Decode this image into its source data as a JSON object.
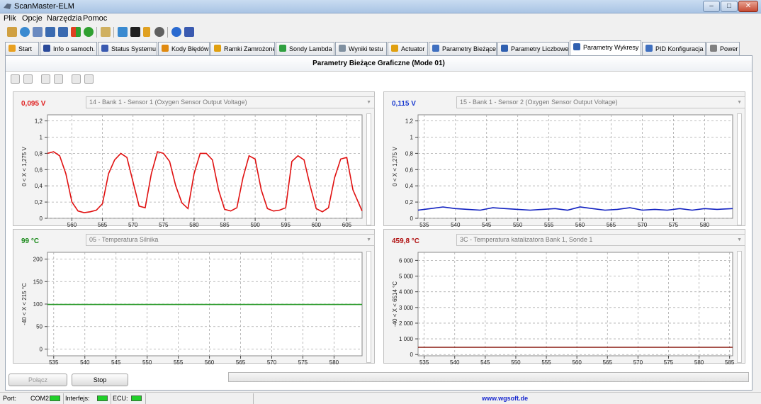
{
  "window": {
    "title": "ScanMaster-ELM",
    "min_label": "–",
    "max_label": "□",
    "close_label": "✕"
  },
  "menu": [
    "Plik",
    "Opcje",
    "Narzędzia",
    "Pomoc"
  ],
  "toolbar_icons": [
    "connect-icon",
    "globe-icon",
    "document-icon",
    "grid-icon",
    "chart-icon",
    "windows-icon",
    "dollar-icon",
    "clipboard-icon",
    "monitor-icon",
    "terminal-icon",
    "battery-icon",
    "disc-icon",
    "info-icon",
    "book-icon"
  ],
  "tabs": [
    {
      "label": "Start",
      "color": "#e8a020"
    },
    {
      "label": "Info o samoch.",
      "color": "#2a4a9a"
    },
    {
      "label": "Status Systemu",
      "color": "#3a5ab0"
    },
    {
      "label": "Kody Błędów",
      "color": "#e08a10"
    },
    {
      "label": "Ramki Zamrożone",
      "color": "#e0a010"
    },
    {
      "label": "Sondy Lambda",
      "color": "#30a040"
    },
    {
      "label": "Wyniki testu",
      "color": "#8090a0"
    },
    {
      "label": "Actuator",
      "color": "#e0a010"
    },
    {
      "label": "Parametry Bieżące",
      "color": "#4070c0"
    },
    {
      "label": "Parametry Liczbowe",
      "color": "#3060b0"
    },
    {
      "label": "Parametry Wykresy",
      "color": "#3060b0",
      "active": true
    },
    {
      "label": "PID Konfiguracja",
      "color": "#4070c0"
    },
    {
      "label": "Power",
      "color": "#808080"
    }
  ],
  "panel": {
    "title": "Parametry Bieżące Graficzne (Mode 01)"
  },
  "charts": [
    {
      "value": "0,095 V",
      "value_color": "#e02020",
      "pid": "14 - Bank 1 - Sensor 1 (Oxygen Sensor Output Voltage)",
      "ylabel": "0  < X <  1,275  V",
      "line_color": "#e01010"
    },
    {
      "value": "0,115 V",
      "value_color": "#1a3ad0",
      "pid": "15 - Bank 1 - Sensor 2 (Oxygen Sensor Output Voltage)",
      "ylabel": "0  < X <  1,275  V",
      "line_color": "#1020c0"
    },
    {
      "value": "99 °C",
      "value_color": "#1a8a1a",
      "pid": "05 - Temperatura Silnika",
      "ylabel": "-40  < X <  215  °C",
      "line_color": "#2a9a2a"
    },
    {
      "value": "459,8 °C",
      "value_color": "#b01010",
      "pid": "3C - Temperatura katalizatora Bank 1, Sonde 1",
      "ylabel": "-40  < X <  6514  °C",
      "line_color": "#8a1a10"
    }
  ],
  "chart_data": [
    {
      "type": "line",
      "title": "",
      "ylabel": "0  < X <  1,275  V",
      "xlim": [
        556,
        607.5
      ],
      "ylim": [
        0,
        1.275
      ],
      "yticks": [
        0,
        0.2,
        0.4,
        0.6,
        0.8,
        1,
        1.2
      ],
      "ytick_labels": [
        "0",
        "0,2",
        "0,4",
        "0,6",
        "0,8",
        "1",
        "1,2"
      ],
      "xticks": [
        560,
        565,
        570,
        575,
        580,
        585,
        590,
        595,
        600,
        605
      ],
      "series": [
        {
          "x": [
            556,
            557,
            558,
            559,
            560,
            561,
            562,
            563,
            564,
            565,
            566,
            567,
            568,
            569,
            570,
            571,
            572,
            573,
            574,
            575,
            576,
            577,
            578,
            579,
            580,
            581,
            582,
            583,
            584,
            585,
            586,
            587,
            588,
            589,
            590,
            591,
            592,
            593,
            594,
            595,
            596,
            597,
            598,
            599,
            600,
            601,
            602,
            603,
            604,
            605,
            606,
            607.5
          ],
          "y": [
            0.8,
            0.82,
            0.77,
            0.55,
            0.2,
            0.09,
            0.07,
            0.08,
            0.1,
            0.18,
            0.55,
            0.72,
            0.8,
            0.75,
            0.45,
            0.15,
            0.13,
            0.55,
            0.82,
            0.8,
            0.7,
            0.4,
            0.19,
            0.12,
            0.55,
            0.8,
            0.8,
            0.72,
            0.35,
            0.11,
            0.09,
            0.13,
            0.5,
            0.77,
            0.73,
            0.35,
            0.12,
            0.09,
            0.1,
            0.13,
            0.7,
            0.77,
            0.72,
            0.4,
            0.12,
            0.08,
            0.13,
            0.5,
            0.73,
            0.75,
            0.35,
            0.09
          ]
        }
      ]
    },
    {
      "type": "line",
      "title": "",
      "ylabel": "0  < X <  1,275  V",
      "xlim": [
        534,
        584.5
      ],
      "ylim": [
        0,
        1.275
      ],
      "yticks": [
        0,
        0.2,
        0.4,
        0.6,
        0.8,
        1,
        1.2
      ],
      "ytick_labels": [
        "0",
        "0,2",
        "0,4",
        "0,6",
        "0,8",
        "1",
        "1,2"
      ],
      "xticks": [
        535,
        540,
        545,
        550,
        555,
        560,
        565,
        570,
        575,
        580
      ],
      "series": [
        {
          "x": [
            534,
            536,
            538,
            540,
            542,
            544,
            546,
            548,
            550,
            552,
            554,
            556,
            558,
            560,
            562,
            564,
            566,
            568,
            570,
            572,
            574,
            576,
            578,
            580,
            582,
            584.5
          ],
          "y": [
            0.1,
            0.12,
            0.14,
            0.12,
            0.11,
            0.1,
            0.13,
            0.12,
            0.11,
            0.1,
            0.11,
            0.12,
            0.1,
            0.14,
            0.12,
            0.1,
            0.11,
            0.13,
            0.1,
            0.11,
            0.1,
            0.12,
            0.1,
            0.12,
            0.11,
            0.12
          ]
        }
      ]
    },
    {
      "type": "line",
      "title": "",
      "ylabel": "-40  < X <  215  °C",
      "xlim": [
        534,
        584.5
      ],
      "ylim": [
        -15,
        215
      ],
      "yticks": [
        0,
        50,
        100,
        150,
        200
      ],
      "ytick_labels": [
        "0",
        "50",
        "100",
        "150",
        "200"
      ],
      "xticks": [
        535,
        540,
        545,
        550,
        555,
        560,
        565,
        570,
        575,
        580
      ],
      "series": [
        {
          "x": [
            534,
            584.5
          ],
          "y": [
            99,
            99
          ]
        }
      ]
    },
    {
      "type": "line",
      "title": "",
      "ylabel": "-40  < X <  6514  °C",
      "xlim": [
        534,
        585.5
      ],
      "ylim": [
        -80,
        6514
      ],
      "yticks": [
        0,
        1000,
        2000,
        3000,
        4000,
        5000,
        6000
      ],
      "ytick_labels": [
        "0",
        "1 000",
        "2 000",
        "3 000",
        "4 000",
        "5 000",
        "6 000"
      ],
      "xticks": [
        535,
        540,
        545,
        550,
        555,
        560,
        565,
        570,
        575,
        580,
        585
      ],
      "series": [
        {
          "x": [
            534,
            585.5
          ],
          "y": [
            459.8,
            459.8
          ]
        }
      ]
    }
  ],
  "panel_tool_icons": [
    "add-graph-icon",
    "remove-graph-icon",
    "open-icon",
    "save-icon",
    "print-icon",
    "print-preview-icon"
  ],
  "buttons": {
    "connect": "Połącz",
    "stop": "Stop"
  },
  "status": {
    "port_label": "Port:",
    "port_value": "COM2",
    "interface_label": "Interfejs:",
    "ecu_label": "ECU:",
    "website": "www.wgsoft.de"
  }
}
